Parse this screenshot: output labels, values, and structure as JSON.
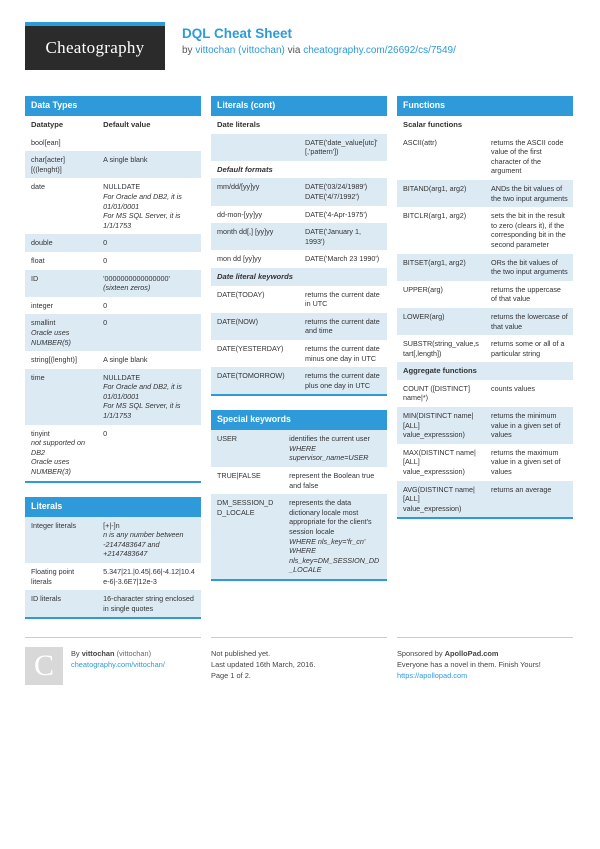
{
  "header": {
    "logo": "Cheatography",
    "title": "DQL Cheat Sheet",
    "by_prefix": "by ",
    "author": "vittochan (vittochan)",
    "via": " via ",
    "source_url": "cheatography.com/26692/cs/7549/"
  },
  "blocks": {
    "data_types": {
      "title": "Data Types",
      "rows": [
        {
          "kind": "hdr",
          "c1": "Datatype",
          "c2": "Default value"
        },
        {
          "kind": "odd",
          "c1": "bool[ean]",
          "c2": ""
        },
        {
          "kind": "even",
          "c1": "char[acter]\n[((lenght)]",
          "c2": "A single blank"
        },
        {
          "kind": "odd",
          "c1": "date",
          "c2": "NULLDATE\nFor Oracle and DB2, it is 01/01/0001\nFor MS SQL Server, it is 1/1/1753",
          "c2_italic_from": 1
        },
        {
          "kind": "even",
          "c1": "double",
          "c2": "0"
        },
        {
          "kind": "odd",
          "c1": "float",
          "c2": "0"
        },
        {
          "kind": "even",
          "c1": "ID",
          "c2": "'0000000000000000'\n(sixteen zeros)",
          "c2_italic_from": 1
        },
        {
          "kind": "odd",
          "c1": "integer",
          "c2": "0"
        },
        {
          "kind": "even",
          "c1": "smallint\nOracle uses NUMBER(5)",
          "c1_italic_from": 1,
          "c2": "0"
        },
        {
          "kind": "odd",
          "c1": "string[(lenght)]",
          "c2": "A single blank"
        },
        {
          "kind": "even",
          "c1": "time",
          "c2": "NULLDATE\nFor Oracle and DB2, it is 01/01/0001\nFor MS SQL Server, it is 1/1/1753",
          "c2_italic_from": 1
        },
        {
          "kind": "odd",
          "c1": "tinyint\nnot supported on DB2\nOracle uses NUMBER(3)",
          "c1_italic_from": 1,
          "c2": "0"
        }
      ]
    },
    "literals": {
      "title": "Literals",
      "rows": [
        {
          "kind": "even",
          "c1": "Integer literals",
          "c2": "[+|-]n\nn is any number between -2147483647 and +2147483647",
          "c2_italic_from": 1
        },
        {
          "kind": "odd",
          "c1": "Floating point literals",
          "c2": "5.347|21.|0.45|.66|-4.12|10.4e-6|-3.6E7|12e-3"
        },
        {
          "kind": "even",
          "c1": "ID literals",
          "c2": "16-character string enclosed in single quotes"
        }
      ]
    },
    "literals_cont": {
      "title": "Literals (cont)",
      "rows": [
        {
          "kind": "sub",
          "c1": "Date literals",
          "colspan": true
        },
        {
          "kind": "even",
          "c1": "",
          "c2": "DATE('date_value[utc]'\n[,'pattern'])"
        },
        {
          "kind": "sub-i",
          "c1": "Default formats",
          "colspan": true
        },
        {
          "kind": "even",
          "c1": "mm/dd/[yy]yy",
          "c2": "DATE('03/24/1989')\nDATE('4/7/1992')"
        },
        {
          "kind": "odd",
          "c1": "dd-mon-[yy]yy",
          "c2": "DATE('4-Apr-1975')"
        },
        {
          "kind": "even",
          "c1": "month dd[,] [yy]yy",
          "c2": "DATE('January 1, 1993')"
        },
        {
          "kind": "odd",
          "c1": "mon dd [yy]yy",
          "c2": "DATE('March 23 1990')"
        },
        {
          "kind": "sub-shade",
          "c1": "Date literal keywords",
          "colspan": true,
          "italic": true
        },
        {
          "kind": "odd",
          "c1": "DATE(TODAY)",
          "c2": "returns the current date in UTC"
        },
        {
          "kind": "even",
          "c1": "DATE(NOW)",
          "c2": "returns the current date and time"
        },
        {
          "kind": "odd",
          "c1": "DATE(YESTERDAY)",
          "c2": "returns the current date minus one day in UTC"
        },
        {
          "kind": "even",
          "c1": "DATE(TOMORROW)",
          "c2": "returns the current date plus one day in UTC"
        }
      ]
    },
    "special_keywords": {
      "title": "Special keywords",
      "rows": [
        {
          "kind": "even",
          "c1": "USER",
          "c2": "identifies the current user\nWHERE\nsupervisor_name=USER",
          "c2_italic_from": 1
        },
        {
          "kind": "odd",
          "c1": "TRUE|FALSE",
          "c2": "represent the Boolean true and false"
        },
        {
          "kind": "even",
          "c1": "DM_SESSION_DD_LOCALE",
          "c2": "represents the data dictionary locale most appropriate for the client's session locale\nWHERE nls_key='fr_cn'\nWHERE\nnls_key=DM_SESSION_DD_LOCALE",
          "c2_italic_from": 1
        }
      ]
    },
    "functions": {
      "title": "Functions",
      "rows": [
        {
          "kind": "sub",
          "c1": "Scalar functions",
          "colspan": true
        },
        {
          "kind": "odd",
          "c1": "ASCII(attr)",
          "c2": "returns the ASCII code value of the first character of the argument"
        },
        {
          "kind": "even",
          "c1": "BITAND(arg1, arg2)",
          "c2": "ANDs the bit values of the two input arguments"
        },
        {
          "kind": "odd",
          "c1": "BITCLR(arg1, arg2)",
          "c2": "sets the bit in the result to zero (clears it), if the corresponding bit in the second parameter"
        },
        {
          "kind": "even",
          "c1": "BITSET(arg1, arg2)",
          "c2": "ORs the bit values of the two input arguments"
        },
        {
          "kind": "odd",
          "c1": "UPPER(arg)",
          "c2": "returns the uppercase of that value"
        },
        {
          "kind": "even",
          "c1": "LOWER(arg)",
          "c2": "returns the lowercase of that value"
        },
        {
          "kind": "odd",
          "c1": "SUBSTR(string_value,start[,length])",
          "c2": "returns some or all of a particular string"
        },
        {
          "kind": "sub-shade",
          "c1": "Aggregate functions",
          "colspan": true
        },
        {
          "kind": "odd",
          "c1": "COUNT ([DISTINCT] name|*)",
          "c2": "counts values"
        },
        {
          "kind": "even",
          "c1": "MIN(DISTINCT name|[ALL] value_expresssion)",
          "c2": "returns the minimum value in a given set of values"
        },
        {
          "kind": "odd",
          "c1": "MAX(DISTINCT name|[ALL] value_expresssion)",
          "c2": "returns the maximum value in a given set of values"
        },
        {
          "kind": "even",
          "c1": "AVG(DISTINCT name|[ALL] value_expression)",
          "c2": "returns an average"
        }
      ]
    }
  },
  "footer": {
    "author_block": {
      "avatar_letter": "C",
      "by_prefix": "By ",
      "author_bold": "vittochan",
      "author_handle": " (vittochan)",
      "profile_url": "cheatography.com/vittochan/"
    },
    "publish_block": {
      "line1": "Not published yet.",
      "line2": "Last updated 16th March, 2016.",
      "line3": "Page 1 of 2."
    },
    "sponsor_block": {
      "prefix": "Sponsored by ",
      "sponsor": "ApolloPad.com",
      "tagline": "Everyone has a novel in them. Finish Yours!",
      "url": "https://apollopad.com"
    }
  },
  "colors": {
    "accent": "#2e9ada",
    "row_shade": "#dceaf4",
    "logo_bg": "#2b2b2b"
  }
}
